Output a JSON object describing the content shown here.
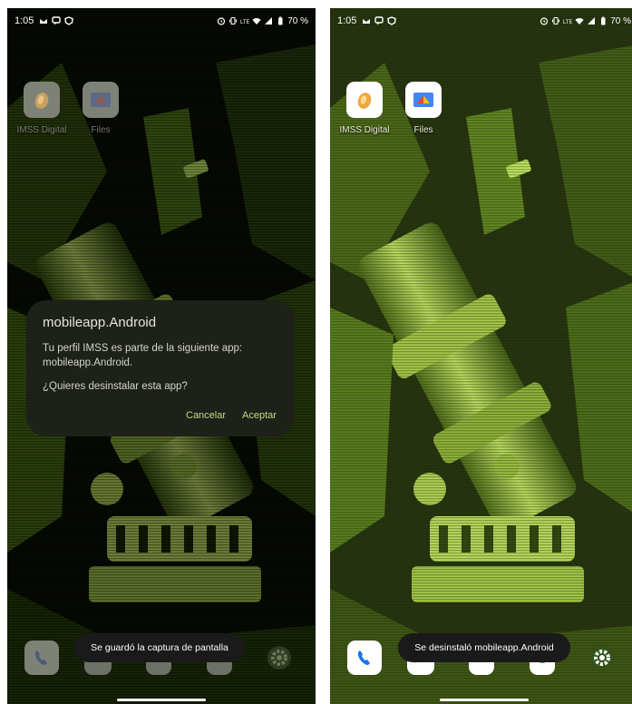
{
  "colors": {
    "wallpaper_dark": "#0c1206",
    "wallpaper_light": "#b6d75a",
    "dialog_bg": "#1d2119",
    "dialog_button": "#c6d889",
    "toast_bg": "#1a1a1a"
  },
  "left_screen": {
    "status": {
      "time": "1:05",
      "battery": "70 %",
      "notification_icons": [
        "mail-icon",
        "chat-icon",
        "shield-icon"
      ],
      "system_icons": [
        "alarm-icon",
        "vibrate-icon",
        "volte-icon",
        "wifi-icon",
        "signal-icon",
        "battery-icon"
      ]
    },
    "apps": [
      {
        "label": "IMSS Digital",
        "icon": "imss-digital-icon"
      },
      {
        "label": "Files",
        "icon": "files-icon"
      }
    ],
    "dialog": {
      "title": "mobileapp.Android",
      "message": "Tu perfil IMSS es parte de la siguiente app: mobileapp.Android.",
      "question": "¿Quieres desinstalar esta app?",
      "cancel": "Cancelar",
      "accept": "Aceptar"
    },
    "toast": "Se guardó la captura de pantalla",
    "dock": [
      "phone-icon",
      "messages-icon",
      "photos-icon",
      "chrome-icon",
      "settings-icon"
    ]
  },
  "right_screen": {
    "status": {
      "time": "1:05",
      "battery": "70 %",
      "notification_icons": [
        "mail-icon",
        "chat-icon",
        "shield-icon"
      ],
      "system_icons": [
        "alarm-icon",
        "vibrate-icon",
        "volte-icon",
        "wifi-icon",
        "signal-icon",
        "battery-icon"
      ]
    },
    "apps": [
      {
        "label": "IMSS Digital",
        "icon": "imss-digital-icon"
      },
      {
        "label": "Files",
        "icon": "files-icon"
      }
    ],
    "toast": "Se desinstaló mobileapp.Android",
    "dock": [
      "phone-icon",
      "messages-icon",
      "photos-icon",
      "chrome-icon",
      "settings-icon"
    ]
  }
}
